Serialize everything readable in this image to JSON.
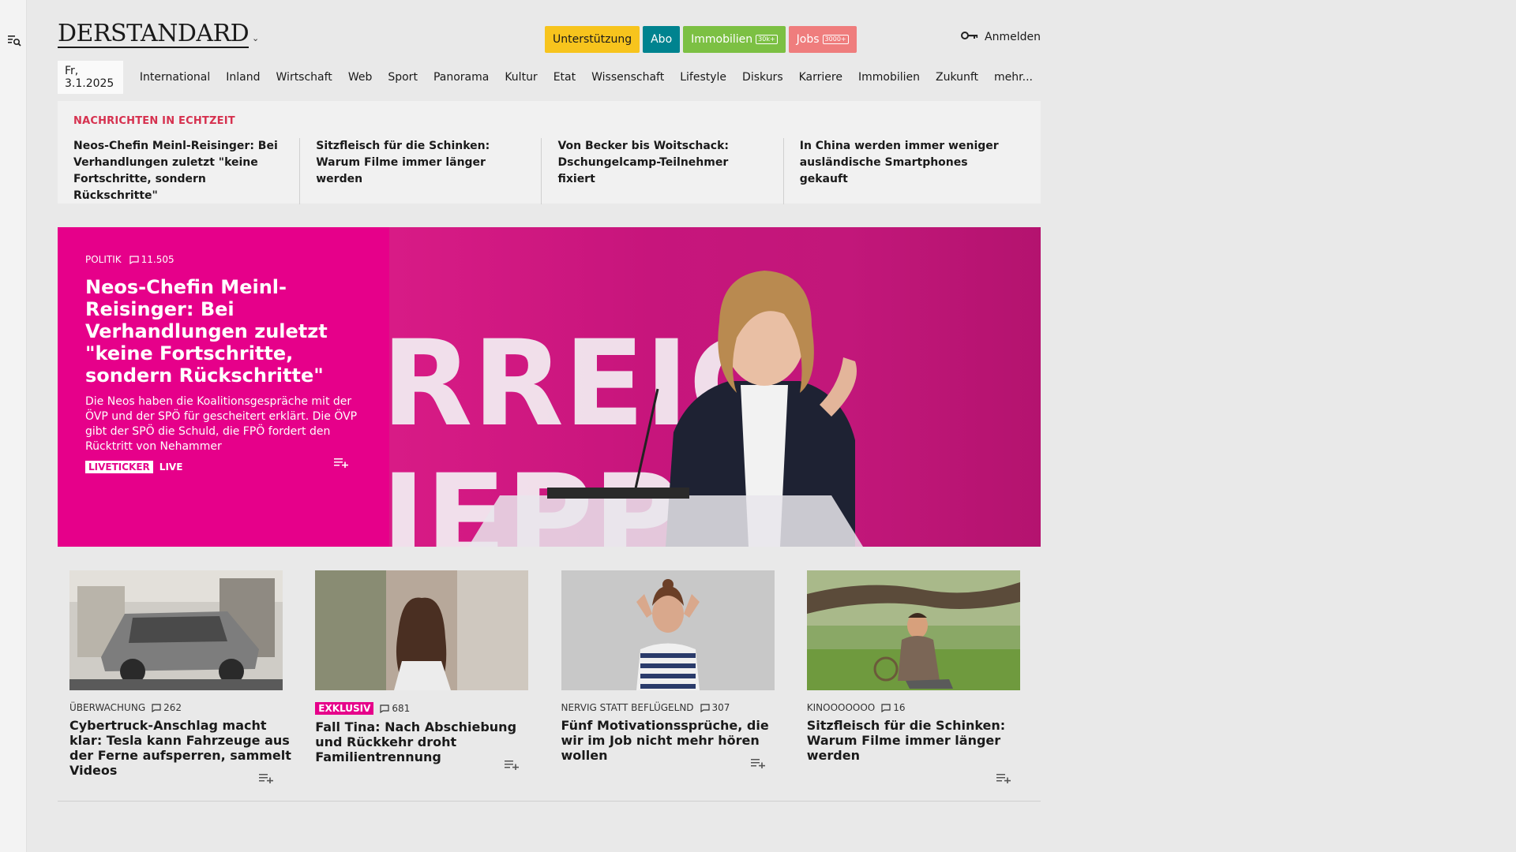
{
  "header": {
    "logo_text": "DERSTANDARD",
    "pills": [
      {
        "label": "Unterstützung",
        "count": "",
        "bg": "#f7c41d",
        "fg": "#1a1a1a"
      },
      {
        "label": "Abo",
        "count": "",
        "bg": "#00838f",
        "fg": "#ffffff"
      },
      {
        "label": "Immobilien",
        "count": "30k+",
        "bg": "#7cc043",
        "fg": "#ffffff"
      },
      {
        "label": "Jobs",
        "count": "3000+",
        "bg": "#ef7d7d",
        "fg": "#ffffff"
      }
    ],
    "login_label": "Anmelden"
  },
  "nav": {
    "date": "Fr, 3.1.2025",
    "items": [
      "International",
      "Inland",
      "Wirtschaft",
      "Web",
      "Sport",
      "Panorama",
      "Kultur",
      "Etat",
      "Wissenschaft",
      "Lifestyle",
      "Diskurs",
      "Karriere",
      "Immobilien",
      "Zukunft",
      "mehr..."
    ]
  },
  "ticker": {
    "kicker": "NACHRICHTEN IN ECHTZEIT",
    "items": [
      "Neos-Chefin Meinl-Reisinger: Bei Ver­handlungen zuletzt \"keine Fort­schritte, sondern Rückschritte\"",
      "Sitzfleisch für die Schinken: Warum Filme immer länger werden",
      "Von Becker bis Woitschack: Dschun­gelcamp-Teilnehmer fixiert",
      "In China werden immer weniger aus­ländische Smartphones gekauft"
    ]
  },
  "hero": {
    "section": "POLITIK",
    "comments": "11.505",
    "title": "Neos-Chefin Meinl-Reisinger: Bei Verhandlungen zuletzt \"keine Fortschritte, sondern Rückschritte\"",
    "teaser": "Die Neos haben die Koalitionsgespräche mit der ÖVP und der SPÖ für gescheitert erklärt. Die ÖVP gibt der SPÖ die Schuld, die FPÖ fordert den Rücktritt von Nehammer",
    "tag_liveticker": "LIVETICKER",
    "tag_live": "LIVE",
    "photo_text": "RREIC",
    "photo_text_2": "IEPP"
  },
  "cards": [
    {
      "kicker": "ÜBERWACHUNG",
      "exclusive": "",
      "comments": "262",
      "title": "Cybertruck-Anschlag macht klar: Tesla kann Fahrzeuge aus der Ferne aufsperren, sammelt Videos"
    },
    {
      "kicker": "",
      "exclusive": "EXKLUSIV",
      "comments": "681",
      "title": "Fall Tina: Nach Abschiebung und Rückkehr droht Familientrennung"
    },
    {
      "kicker": "NERVIG STATT BEFLÜGELND",
      "exclusive": "",
      "comments": "307",
      "title": "Fünf Motivationssprüche, die wir im Job nicht mehr hören wollen"
    },
    {
      "kicker": "KINOOOOOOO",
      "exclusive": "",
      "comments": "16",
      "title": "Sitzfleisch für die Schinken: Warum Filme immer länger werden"
    }
  ]
}
